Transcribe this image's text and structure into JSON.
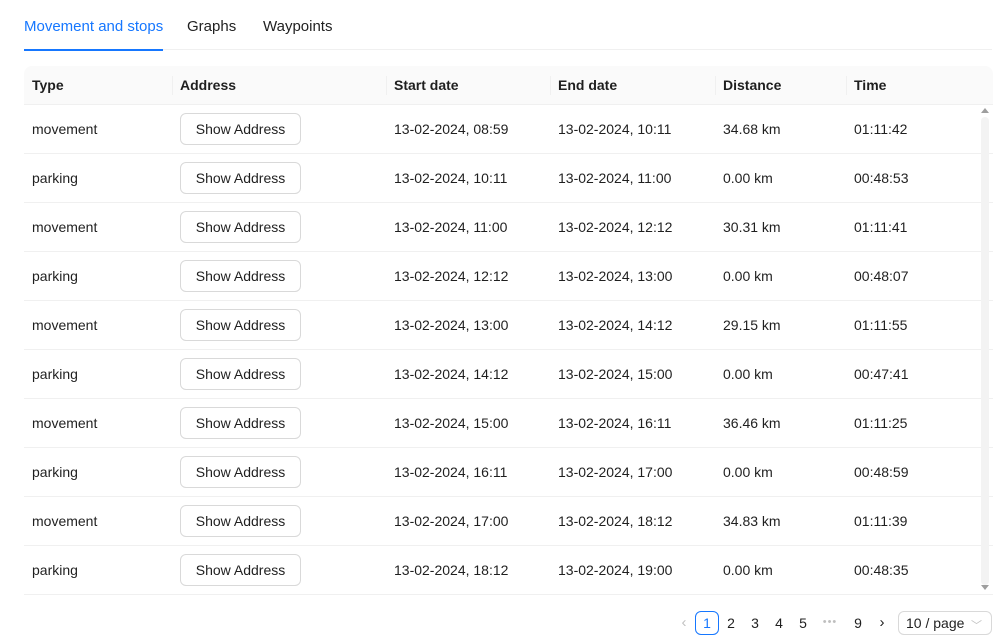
{
  "tabs": [
    {
      "label": "Movement and stops",
      "active": true
    },
    {
      "label": "Graphs",
      "active": false
    },
    {
      "label": "Waypoints",
      "active": false
    }
  ],
  "table": {
    "columns": [
      "Type",
      "Address",
      "Start date",
      "End date",
      "Distance",
      "Time"
    ],
    "address_button_label": "Show Address",
    "rows": [
      {
        "type": "movement",
        "start": "13-02-2024, 08:59",
        "end": "13-02-2024, 10:11",
        "distance": "34.68 km",
        "time": "01:11:42"
      },
      {
        "type": "parking",
        "start": "13-02-2024, 10:11",
        "end": "13-02-2024, 11:00",
        "distance": "0.00 km",
        "time": "00:48:53"
      },
      {
        "type": "movement",
        "start": "13-02-2024, 11:00",
        "end": "13-02-2024, 12:12",
        "distance": "30.31 km",
        "time": "01:11:41"
      },
      {
        "type": "parking",
        "start": "13-02-2024, 12:12",
        "end": "13-02-2024, 13:00",
        "distance": "0.00 km",
        "time": "00:48:07"
      },
      {
        "type": "movement",
        "start": "13-02-2024, 13:00",
        "end": "13-02-2024, 14:12",
        "distance": "29.15 km",
        "time": "01:11:55"
      },
      {
        "type": "parking",
        "start": "13-02-2024, 14:12",
        "end": "13-02-2024, 15:00",
        "distance": "0.00 km",
        "time": "00:47:41"
      },
      {
        "type": "movement",
        "start": "13-02-2024, 15:00",
        "end": "13-02-2024, 16:11",
        "distance": "36.46 km",
        "time": "01:11:25"
      },
      {
        "type": "parking",
        "start": "13-02-2024, 16:11",
        "end": "13-02-2024, 17:00",
        "distance": "0.00 km",
        "time": "00:48:59"
      },
      {
        "type": "movement",
        "start": "13-02-2024, 17:00",
        "end": "13-02-2024, 18:12",
        "distance": "34.83 km",
        "time": "01:11:39"
      },
      {
        "type": "parking",
        "start": "13-02-2024, 18:12",
        "end": "13-02-2024, 19:00",
        "distance": "0.00 km",
        "time": "00:48:35"
      }
    ]
  },
  "pagination": {
    "prev_icon": "chevron-left-icon",
    "next_icon": "chevron-right-icon",
    "pages": [
      "1",
      "2",
      "3",
      "4",
      "5"
    ],
    "current": "1",
    "ellipsis": "•••",
    "last_page": "9",
    "page_size": "10 / page",
    "page_size_icon": "chevron-down-icon"
  },
  "colors": {
    "accent": "#1677ff",
    "border": "#f0f0f0",
    "header_bg": "#fafafa"
  }
}
